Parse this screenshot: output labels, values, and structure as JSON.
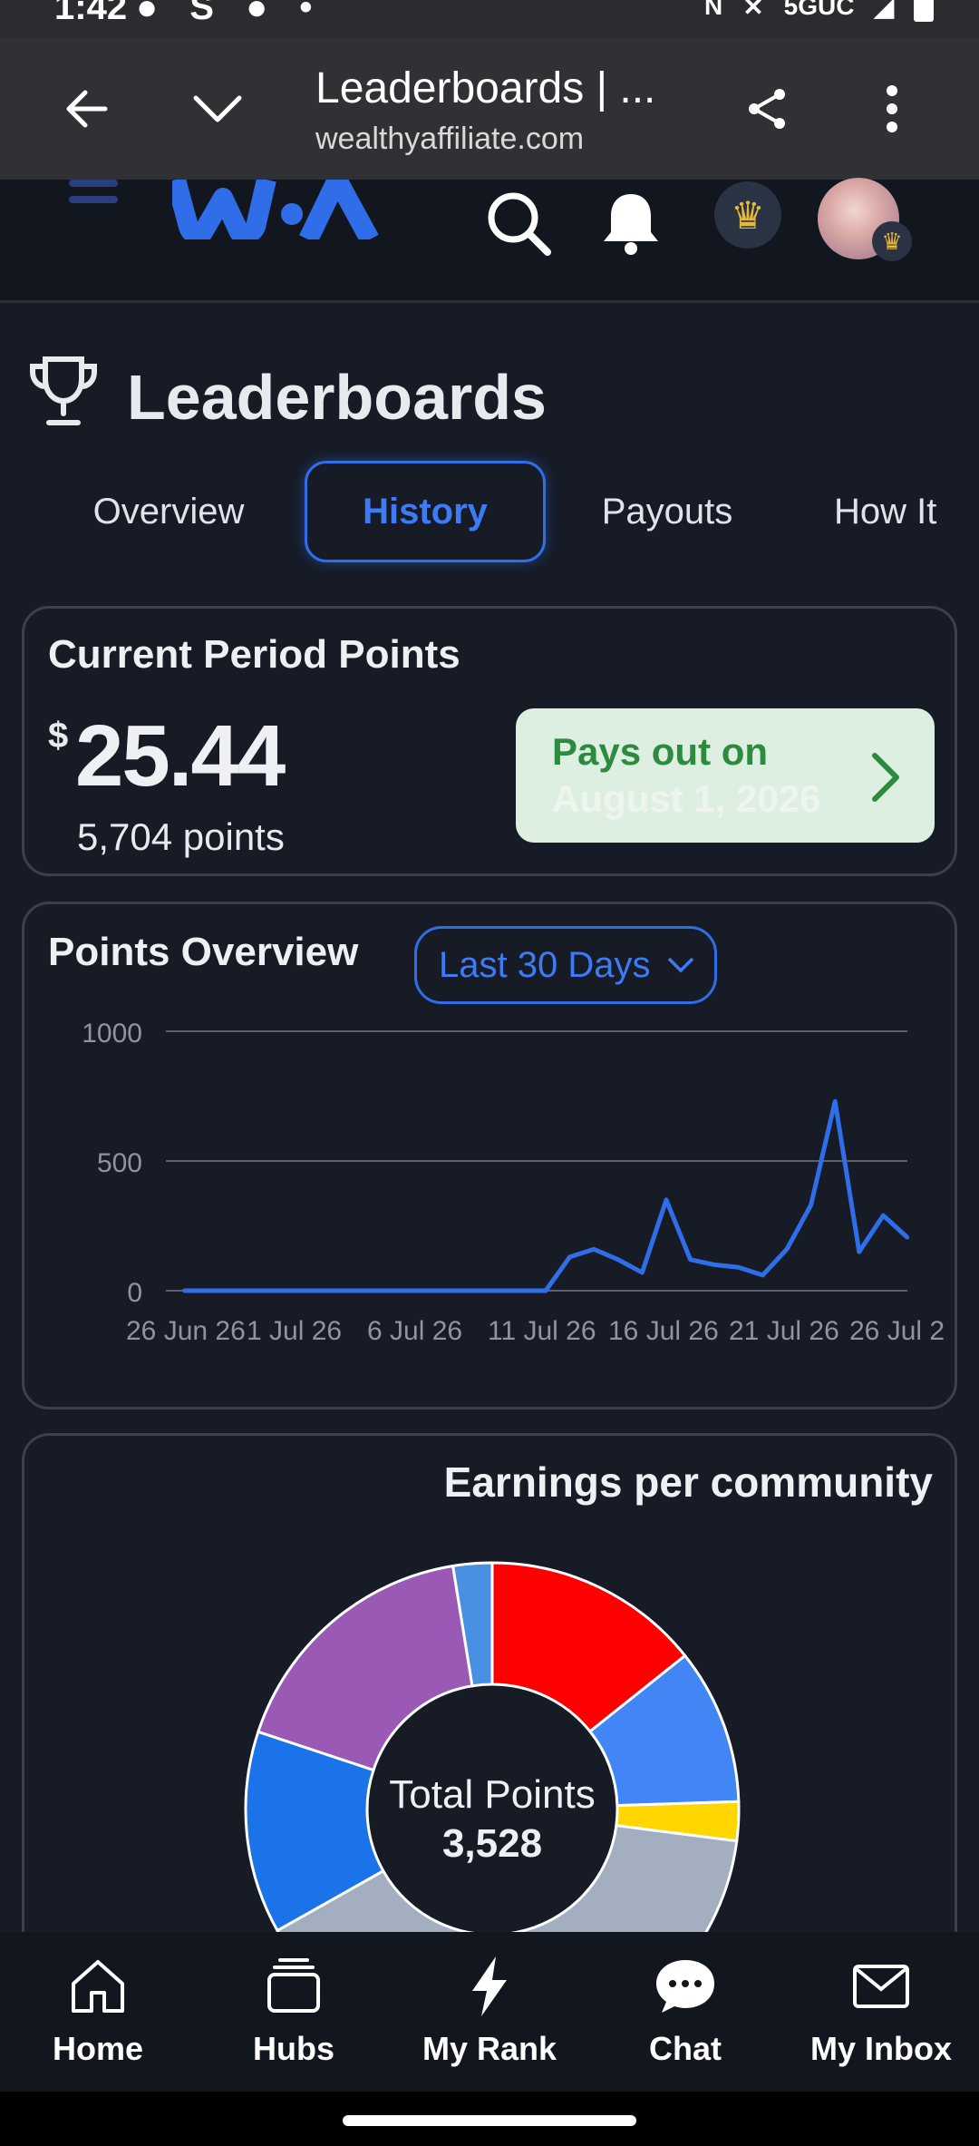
{
  "status_bar": {
    "time": "1:42",
    "network": "5GUC"
  },
  "browser": {
    "tab_title": "Leaderboards | ...",
    "url": "wealthyaffiliate.com"
  },
  "page": {
    "title": "Leaderboards"
  },
  "tabs": [
    {
      "label": "Overview",
      "active": false
    },
    {
      "label": "History",
      "active": true
    },
    {
      "label": "Payouts",
      "active": false
    },
    {
      "label": "How It",
      "active": false
    }
  ],
  "current_period": {
    "title": "Current Period Points",
    "currency": "$",
    "amount": "25.44",
    "points": "5,704 points",
    "payout_label": "Pays out on",
    "payout_date": "August 1, 2026"
  },
  "points_overview": {
    "title": "Points Overview",
    "range_select": "Last 30 Days"
  },
  "earnings": {
    "title": "Earnings per community",
    "center_label": "Total Points",
    "center_value": "3,528"
  },
  "bottom_nav": [
    {
      "label": "Home",
      "icon": "home-icon"
    },
    {
      "label": "Hubs",
      "icon": "hubs-icon"
    },
    {
      "label": "My Rank",
      "icon": "lightning-icon"
    },
    {
      "label": "Chat",
      "icon": "chat-icon"
    },
    {
      "label": "My Inbox",
      "icon": "mail-icon"
    }
  ],
  "colors": {
    "accent": "#2f6ee8",
    "payout_bg": "#ddefe0",
    "payout_text": "#2d8a3e"
  },
  "chart_data": [
    {
      "type": "line",
      "title": "Points Overview",
      "y_ticks": [
        "0",
        "500",
        "1000"
      ],
      "ylim": [
        0,
        1000
      ],
      "x_tick_labels": [
        "26 Jun 26",
        "1 Jul 26",
        "6 Jul 26",
        "11 Jul 26",
        "16 Jul 26",
        "21 Jul 26",
        "26 Jul 2"
      ],
      "series": [
        {
          "color": "#2f6ee8",
          "x": [
            0,
            15,
            16,
            17,
            18,
            19,
            20,
            21,
            22,
            23,
            24,
            25,
            26,
            27,
            28,
            29,
            30
          ],
          "values": [
            0,
            0,
            130,
            160,
            120,
            70,
            350,
            120,
            100,
            90,
            60,
            160,
            330,
            730,
            150,
            290,
            205
          ]
        }
      ]
    },
    {
      "type": "pie",
      "title": "Earnings per community",
      "center_label": "Total Points",
      "center_value": 3528,
      "slices": [
        {
          "color": "#ff0000",
          "value": 14
        },
        {
          "color": "#4285f4",
          "value": 10
        },
        {
          "color": "#ffd600",
          "value": 2.5
        },
        {
          "color": "#a3aec0",
          "value": 39
        },
        {
          "color": "#1a73e8",
          "value": 13
        },
        {
          "color": "#9b59b6",
          "value": 17
        },
        {
          "color": "#4a90e2",
          "value": 2.5
        }
      ]
    }
  ]
}
